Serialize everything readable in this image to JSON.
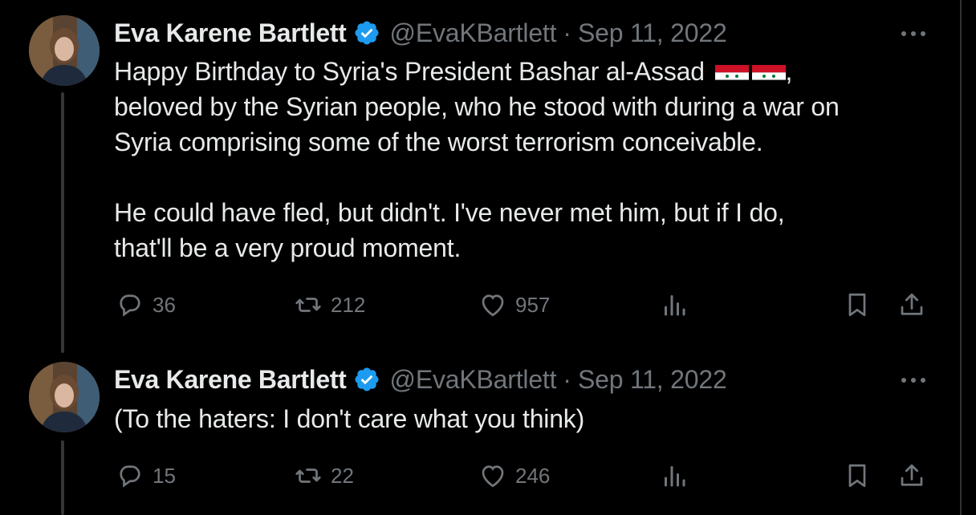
{
  "tweets": [
    {
      "display_name": "Eva Karene Bartlett",
      "handle": "@EvaKBartlett",
      "separator": "·",
      "date": "Sep 11, 2022",
      "text_lines": [
        "Happy Birthday to Syria's President Bashar al-Assad",
        "beloved by the Syrian people, who he stood with during a war on",
        "Syria comprising some of the worst terrorism conceivable."
      ],
      "text_line1_suffix": ",",
      "text_para2": [
        "He could have fled, but didn't. I've never met him, but if I do,",
        "that'll be a very proud moment."
      ],
      "replies": "36",
      "retweets": "212",
      "likes": "957"
    },
    {
      "display_name": "Eva Karene Bartlett",
      "handle": "@EvaKBartlett",
      "separator": "·",
      "date": "Sep 11, 2022",
      "text": "(To the haters: I don't care what you think)",
      "replies": "15",
      "retweets": "22",
      "likes": "246"
    }
  ],
  "colors": {
    "background": "#000000",
    "primary_text": "#e7e9ea",
    "secondary_text": "#71767b",
    "verified_badge": "#1d9bf0",
    "thread_line": "#333639"
  },
  "icons": [
    "verified-badge-icon",
    "more-icon",
    "reply-icon",
    "retweet-icon",
    "like-icon",
    "views-icon",
    "bookmark-icon",
    "share-icon",
    "syria-flag-icon"
  ]
}
